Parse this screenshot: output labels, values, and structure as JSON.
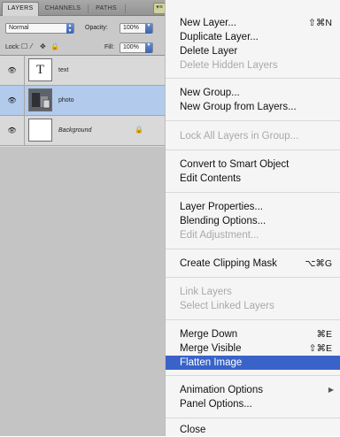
{
  "panel": {
    "tabs": [
      "LAYERS",
      "CHANNELS",
      "PATHS"
    ],
    "blend_mode": "Normal",
    "opacity_label": "Opacity:",
    "opacity_value": "100%",
    "lock_label": "Lock:",
    "fill_label": "Fill:",
    "fill_value": "100%",
    "layers": [
      {
        "name": "text",
        "thumb": "T"
      },
      {
        "name": "photo"
      },
      {
        "name": "Background"
      }
    ]
  },
  "menu": {
    "new_layer": "New Layer...",
    "new_layer_shortcut": "⇧⌘N",
    "duplicate_layer": "Duplicate Layer...",
    "delete_layer": "Delete Layer",
    "delete_hidden": "Delete Hidden Layers",
    "new_group": "New Group...",
    "new_group_from_layers": "New Group from Layers...",
    "lock_all": "Lock All Layers in Group...",
    "convert_smart": "Convert to Smart Object",
    "edit_contents": "Edit Contents",
    "layer_properties": "Layer Properties...",
    "blending_options": "Blending Options...",
    "edit_adjustment": "Edit Adjustment...",
    "clipping_mask": "Create Clipping Mask",
    "clipping_mask_shortcut": "⌥⌘G",
    "link_layers": "Link Layers",
    "select_linked": "Select Linked Layers",
    "merge_down": "Merge Down",
    "merge_down_shortcut": "⌘E",
    "merge_visible": "Merge Visible",
    "merge_visible_shortcut": "⇧⌘E",
    "flatten_image": "Flatten Image",
    "animation_options": "Animation Options",
    "panel_options": "Panel Options...",
    "close": "Close"
  }
}
